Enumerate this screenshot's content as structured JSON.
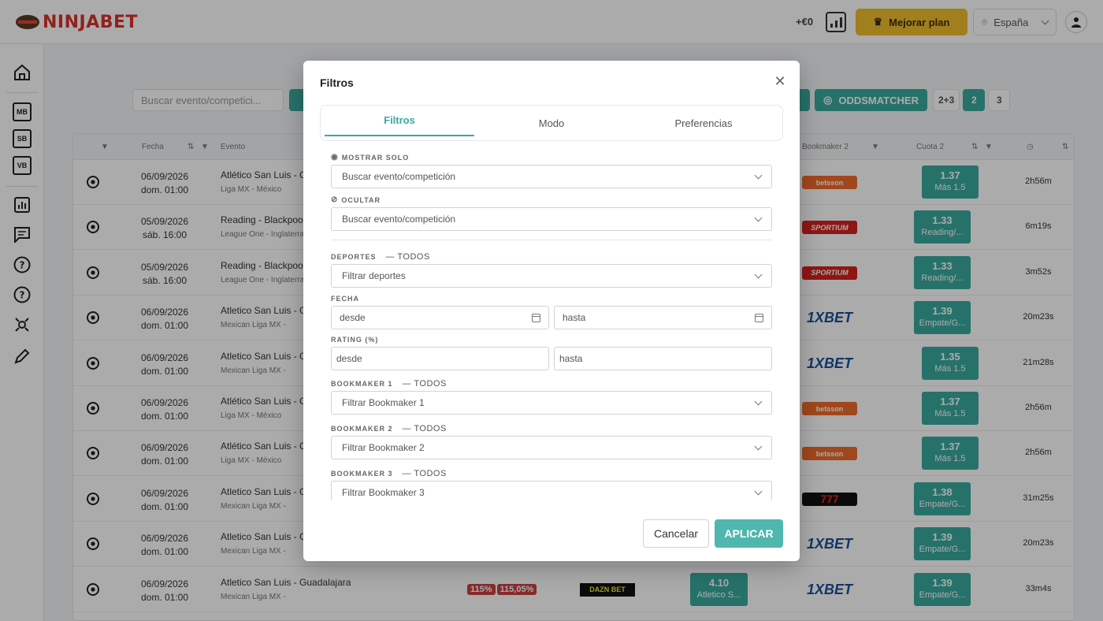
{
  "header": {
    "brand": "NINJABET",
    "balance": "+€0",
    "upgrade_label": "Mejorar plan",
    "country": "España"
  },
  "sidebar": {
    "items": [
      {
        "name": "home",
        "label": ""
      },
      {
        "name": "mb",
        "label": "MB"
      },
      {
        "name": "sb",
        "label": "SB"
      },
      {
        "name": "vb",
        "label": "VB"
      },
      {
        "name": "stats",
        "label": ""
      },
      {
        "name": "chat",
        "label": ""
      },
      {
        "name": "help",
        "label": ""
      },
      {
        "name": "help2",
        "label": ""
      },
      {
        "name": "tools",
        "label": ""
      },
      {
        "name": "edit",
        "label": ""
      }
    ]
  },
  "toolbar": {
    "search_placeholder": "Buscar evento/competici...",
    "oddsmatcher_label": "ODDSMATCHER",
    "pages": [
      "2+3",
      "2",
      "3"
    ],
    "active_page": "2"
  },
  "table": {
    "headers": {
      "fecha": "Fecha",
      "evento": "Evento",
      "bookmaker2": "Bookmaker 2",
      "cuota2": "Cuota 2"
    },
    "rows": [
      {
        "date": "06/09/2026",
        "time": "dom. 01:00",
        "event": "Atlético San Luis - Ch",
        "league": "Liga MX - México",
        "bk2": "betsson",
        "odd": "1.37",
        "market": "Más 1.5",
        "remaining": "2h56m"
      },
      {
        "date": "05/09/2026",
        "time": "sáb. 16:00",
        "event": "Reading - Blackpool",
        "league": "League One - Inglaterra",
        "bk2": "SPORTIUM",
        "odd": "1.33",
        "market": "Reading/...",
        "remaining": "6m19s"
      },
      {
        "date": "05/09/2026",
        "time": "sáb. 16:00",
        "event": "Reading - Blackpool",
        "league": "League One - Inglaterra",
        "bk2": "SPORTIUM",
        "odd": "1.33",
        "market": "Reading/...",
        "remaining": "3m52s"
      },
      {
        "date": "06/09/2026",
        "time": "dom. 01:00",
        "event": "Atletico San Luis - Gu",
        "league": "Mexican Liga MX -",
        "bk2": "1XBET",
        "odd": "1.39",
        "market": "Empate/G...",
        "remaining": "20m23s"
      },
      {
        "date": "06/09/2026",
        "time": "dom. 01:00",
        "event": "Atletico San Luis - Gu",
        "league": "Mexican Liga MX -",
        "bk2": "1XBET",
        "odd": "1.35",
        "market": "Más 1.5",
        "remaining": "21m28s"
      },
      {
        "date": "06/09/2026",
        "time": "dom. 01:00",
        "event": "Atlético San Luis - Ch",
        "league": "Liga MX - México",
        "bk2": "betsson",
        "odd": "1.37",
        "market": "Más 1.5",
        "remaining": "2h56m"
      },
      {
        "date": "06/09/2026",
        "time": "dom. 01:00",
        "event": "Atlético San Luis - Ch",
        "league": "Liga MX - México",
        "bk2": "betsson",
        "odd": "1.37",
        "market": "Más 1.5",
        "remaining": "2h56m"
      },
      {
        "date": "06/09/2026",
        "time": "dom. 01:00",
        "event": "Atletico San Luis - Gu",
        "league": "Mexican Liga MX -",
        "bk2": "777",
        "odd": "1.38",
        "market": "Empate/G...",
        "remaining": "31m25s"
      },
      {
        "date": "06/09/2026",
        "time": "dom. 01:00",
        "event": "Atletico San Luis - Gu",
        "league": "Mexican Liga MX -",
        "bk2": "1XBET",
        "odd": "1.39",
        "market": "Empate/G...",
        "remaining": "20m23s"
      },
      {
        "date": "06/09/2026",
        "time": "dom. 01:00",
        "event": "Atletico San Luis - Guadalajara",
        "league": "Mexican Liga MX -",
        "bk2": "1XBET",
        "odd": "1.39",
        "market": "Empate/G...",
        "remaining": "33m4s"
      }
    ],
    "last_row_extra": {
      "rating1": "115%",
      "rating2": "115,05%",
      "bk1": "DAZN BET",
      "odd1": "4.10",
      "market1": "Atletico S..."
    }
  },
  "modal": {
    "title": "Filtros",
    "tabs": [
      "Filtros",
      "Modo",
      "Preferencias"
    ],
    "active_tab": "Filtros",
    "fields": {
      "mostrar_solo_label": "MOSTRAR SOLO",
      "mostrar_solo_placeholder": "Buscar evento/competición",
      "ocultar_label": "OCULTAR",
      "ocultar_placeholder": "Buscar evento/competición",
      "deportes_label": "DEPORTES",
      "deportes_todos": "— TODOS",
      "deportes_placeholder": "Filtrar deportes",
      "fecha_label": "FECHA",
      "fecha_desde": "desde",
      "fecha_hasta": "hasta",
      "rating_label": "RATING (%)",
      "rating_desde": "desde",
      "rating_hasta": "hasta",
      "bk1_label": "BOOKMAKER 1",
      "bk1_todos": "— TODOS",
      "bk1_placeholder": "Filtrar Bookmaker 1",
      "bk2_label": "BOOKMAKER 2",
      "bk2_todos": "— TODOS",
      "bk2_placeholder": "Filtrar Bookmaker 2",
      "bk3_label": "BOOKMAKER 3",
      "bk3_todos": "— TODOS",
      "bk3_placeholder": "Filtrar Bookmaker 3"
    },
    "cancel_label": "Cancelar",
    "apply_label": "APLICAR"
  },
  "colors": {
    "accent": "#3aaa9f",
    "brand": "#d9322a",
    "upgrade": "#f1bd2e"
  }
}
